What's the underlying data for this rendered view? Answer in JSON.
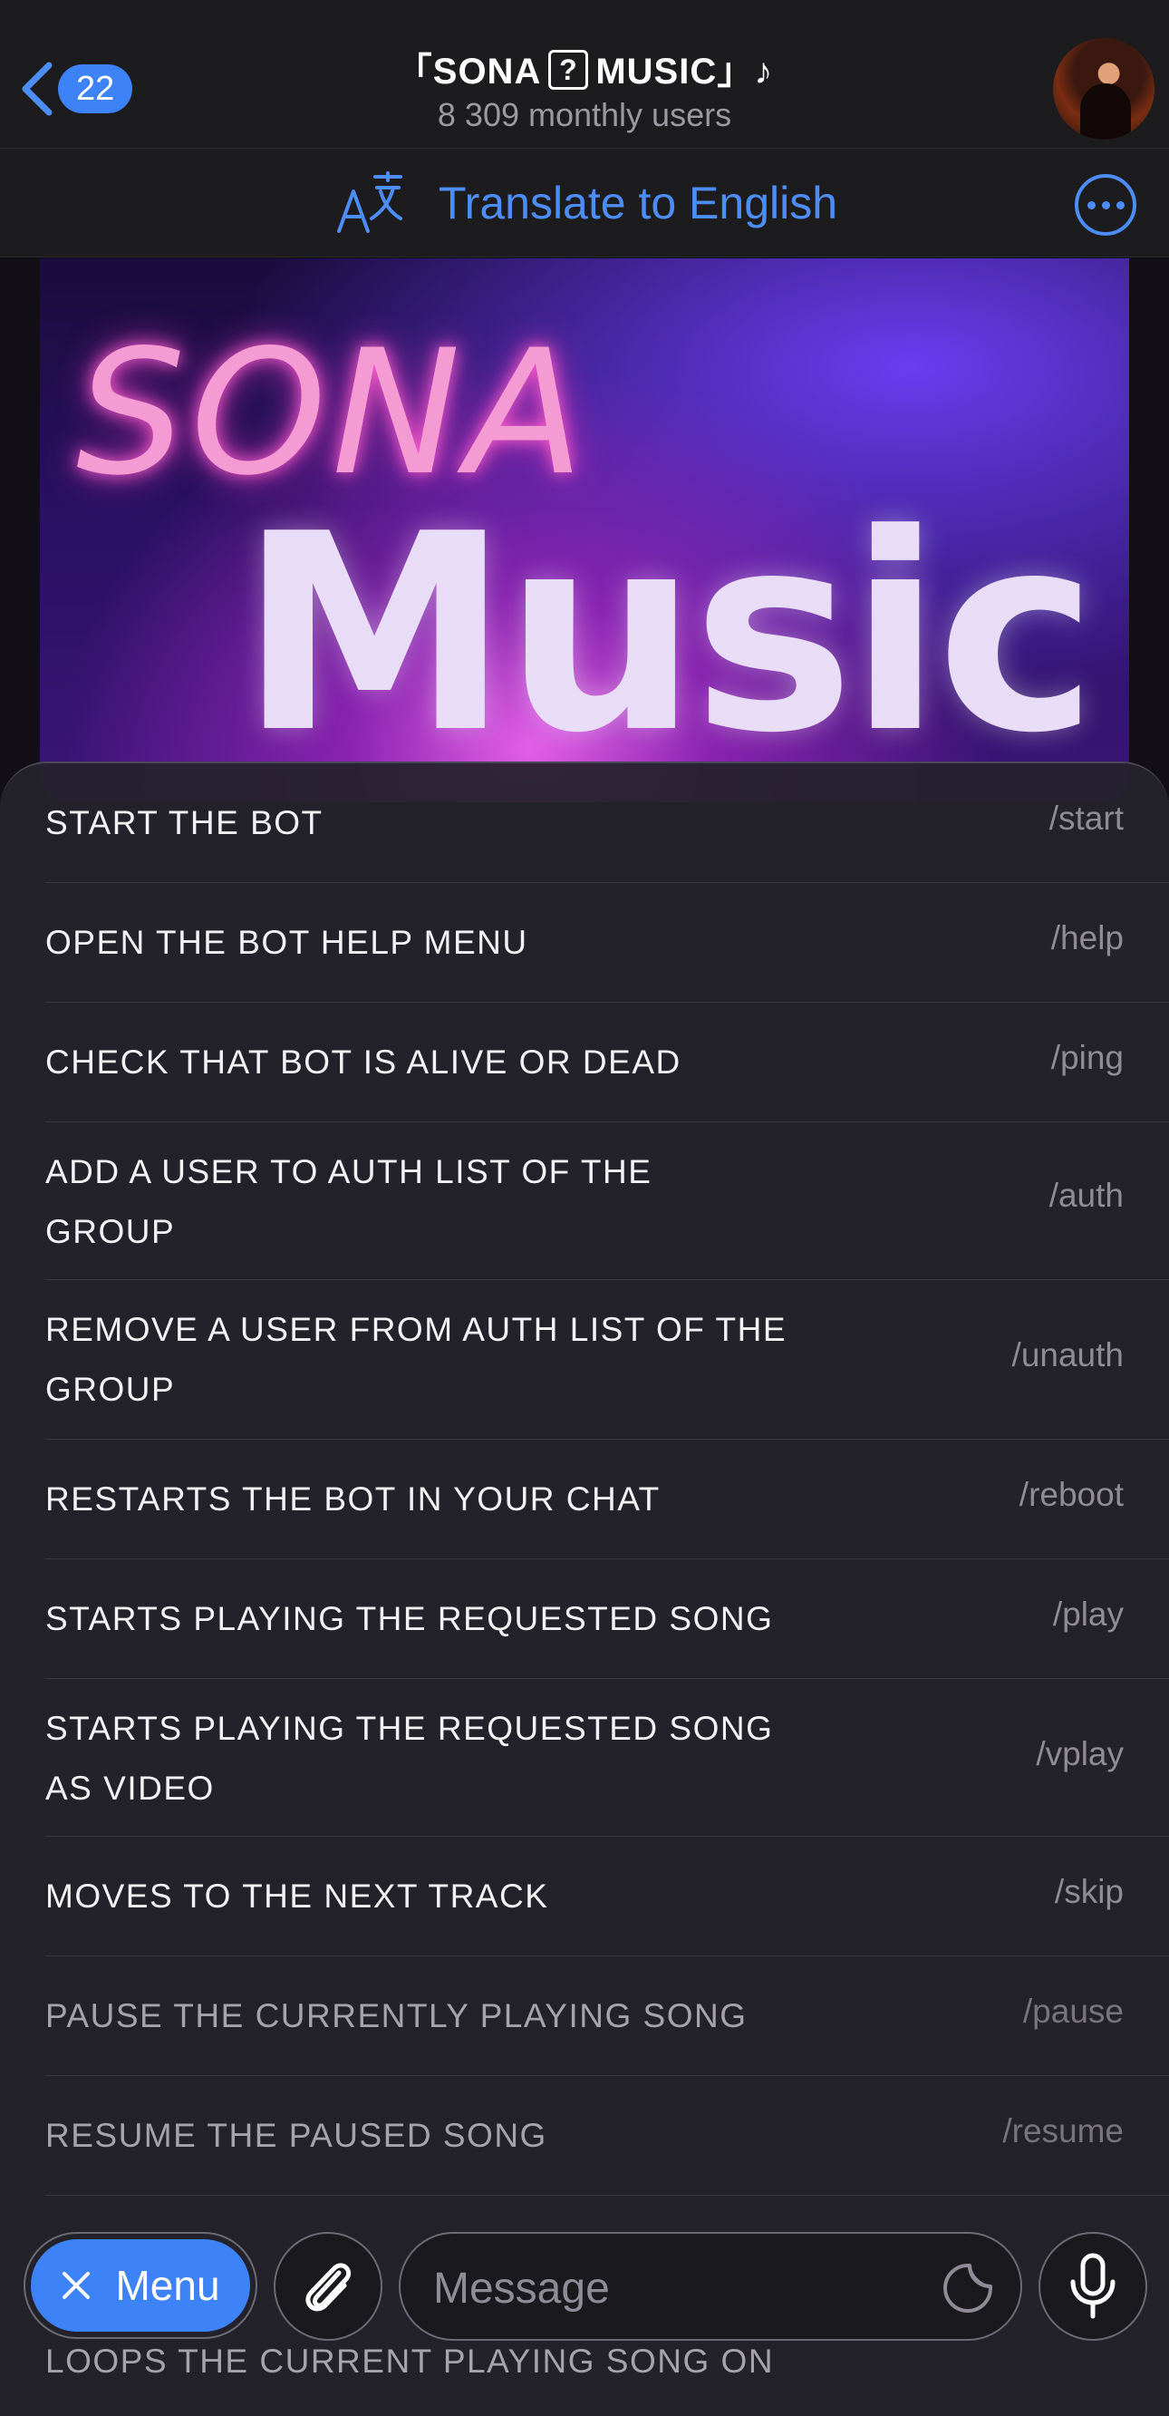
{
  "header": {
    "back_count": "22",
    "title_left": "「SONA",
    "title_glyph": "?",
    "title_right": "MUSIC」♪",
    "subtitle": "8 309 monthly users"
  },
  "translate_bar": {
    "label": "Translate to English"
  },
  "banner": {
    "word_top": "SONA",
    "word_bottom": "Music"
  },
  "commands": [
    {
      "description": "START THE BOT",
      "command": "/start"
    },
    {
      "description": "OPEN THE BOT HELP MENU",
      "command": "/help"
    },
    {
      "description": "CHECK THAT BOT IS ALIVE OR DEAD",
      "command": "/ping"
    },
    {
      "description": "ADD A USER TO AUTH LIST OF THE GROUP",
      "command": "/auth"
    },
    {
      "description": "REMOVE A USER FROM AUTH LIST OF THE GROUP",
      "command": "/unauth"
    },
    {
      "description": "RESTARTS THE BOT IN YOUR CHAT",
      "command": "/reboot"
    },
    {
      "description": "STARTS PLAYING THE REQUESTED SONG",
      "command": "/play"
    },
    {
      "description": "STARTS PLAYING THE REQUESTED SONG AS VIDEO",
      "command": "/vplay"
    },
    {
      "description": "MOVES TO THE NEXT TRACK",
      "command": "/skip"
    },
    {
      "description": "PAUSE THE CURRENTLY PLAYING SONG",
      "command": "/pause"
    },
    {
      "description": "RESUME THE PAUSED SONG",
      "command": "/resume"
    },
    {
      "description": "LOOPS THE CURRENT PLAYING SONG ON",
      "command": ""
    }
  ],
  "input_bar": {
    "menu_label": "Menu",
    "message_placeholder": "Message"
  },
  "colors": {
    "accent": "#3e82f7",
    "link": "#4d8ef6",
    "panel": "#24222c"
  }
}
